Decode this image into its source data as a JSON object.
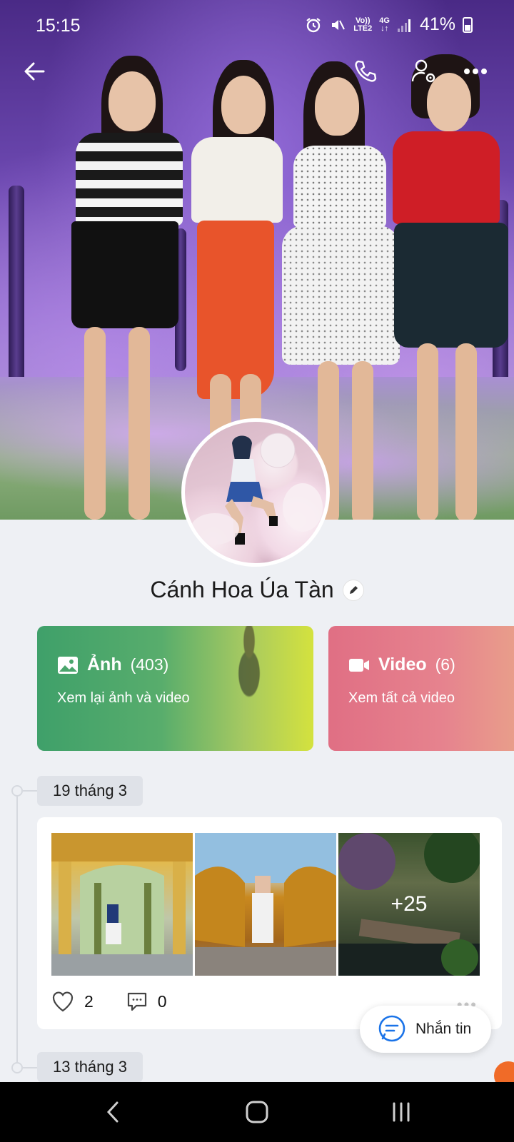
{
  "status_bar": {
    "time": "15:15",
    "network_volte": "Vo))",
    "network_lte": "LTE2",
    "network_4g": "4G",
    "battery": "41%"
  },
  "profile": {
    "name": "Cánh Hoa Úa Tàn"
  },
  "media": {
    "photos": {
      "title": "Ảnh",
      "count": "(403)",
      "subtitle": "Xem lại ảnh và video",
      "icon": "image-icon"
    },
    "videos": {
      "title": "Video",
      "count": "(6)",
      "subtitle": "Xem tất cả video",
      "icon": "video-camera-icon"
    }
  },
  "timeline": {
    "posts": [
      {
        "date": "19 tháng 3",
        "extra_photos": "+25",
        "likes": "2",
        "comments": "0"
      }
    ],
    "next_date": "13 tháng 3"
  },
  "message_button": {
    "label": "Nhắn tin"
  },
  "colors": {
    "photo_card": "#3fa06a",
    "video_card": "#e06f84",
    "accent_blue": "#1a73e8"
  }
}
